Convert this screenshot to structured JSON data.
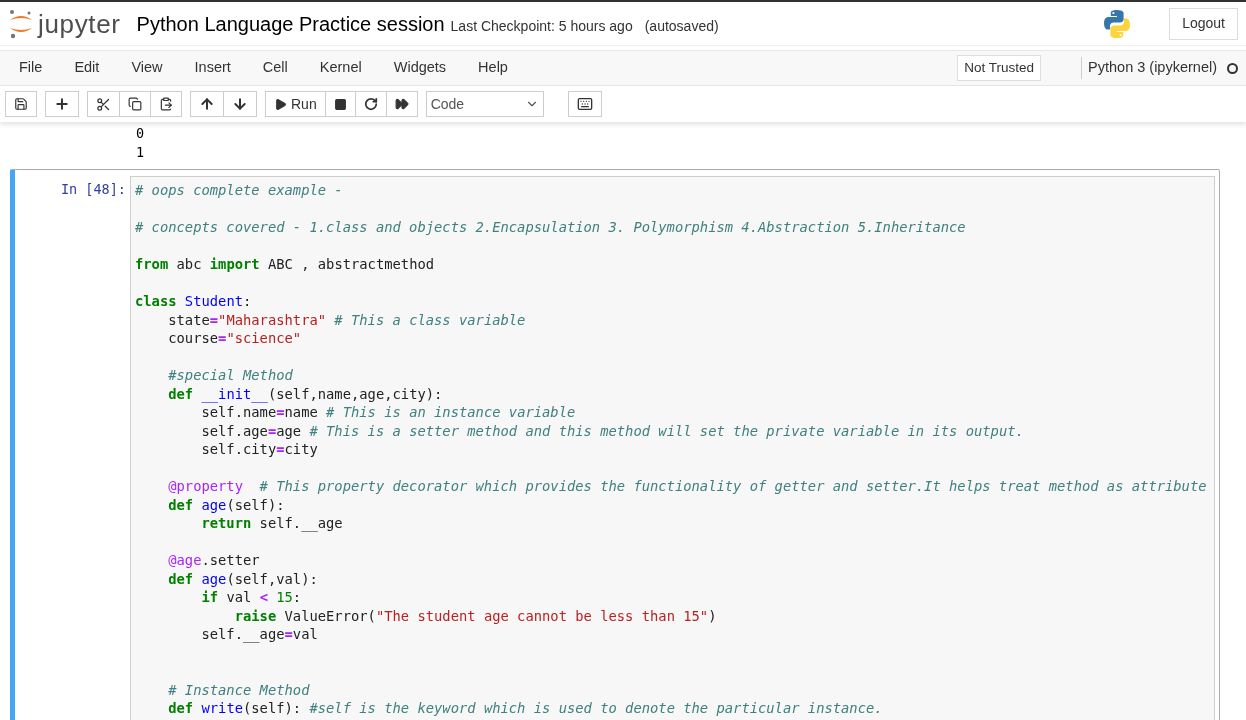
{
  "header": {
    "logo_text": "jupyter",
    "notebook_title": "Python Language Practice session",
    "checkpoint": "Last Checkpoint: 5 hours ago",
    "autosave": "(autosaved)",
    "logout": "Logout"
  },
  "menu": [
    "File",
    "Edit",
    "View",
    "Insert",
    "Cell",
    "Kernel",
    "Widgets",
    "Help"
  ],
  "trust": "Not Trusted",
  "kernel": {
    "name": "Python 3 (ipykernel)",
    "busy": false
  },
  "toolbar": {
    "run_label": "Run",
    "cell_type": "Code"
  },
  "output_lines": [
    "0",
    "1"
  ],
  "cell": {
    "prompt": "In [48]:",
    "selected": true,
    "lines": [
      {
        "kind": "code",
        "tokens": [
          {
            "text": "# oops complete example -",
            "kind": "comment"
          }
        ]
      },
      {
        "kind": "blank"
      },
      {
        "kind": "code",
        "tokens": [
          {
            "text": "# concepts covered - 1.class and objects 2.Encapsulation 3. Polymorphism 4.Abstraction 5.Inheritance",
            "kind": "comment"
          }
        ]
      },
      {
        "kind": "blank"
      },
      {
        "kind": "code",
        "tokens": [
          {
            "text": "from",
            "kind": "kw"
          },
          {
            "text": " abc ",
            "kind": "plain"
          },
          {
            "text": "import",
            "kind": "kw"
          },
          {
            "text": " ABC , abstractmethod",
            "kind": "plain"
          }
        ]
      },
      {
        "kind": "blank"
      },
      {
        "kind": "code",
        "tokens": [
          {
            "text": "class",
            "kind": "kw"
          },
          {
            "text": " Student",
            "kind": "name"
          },
          {
            "text": ":",
            "kind": "plain"
          }
        ]
      },
      {
        "kind": "code",
        "tokens": [
          {
            "text": "    state",
            "kind": "plain"
          },
          {
            "text": "=",
            "kind": "op"
          },
          {
            "text": "\"Maharashtra\"",
            "kind": "str"
          },
          {
            "text": " # This a class variable",
            "kind": "comment"
          }
        ]
      },
      {
        "kind": "code",
        "tokens": [
          {
            "text": "    course",
            "kind": "plain"
          },
          {
            "text": "=",
            "kind": "op"
          },
          {
            "text": "\"science\"",
            "kind": "str"
          }
        ]
      },
      {
        "kind": "blank"
      },
      {
        "kind": "code",
        "tokens": [
          {
            "text": "    #special Method",
            "kind": "comment"
          }
        ]
      },
      {
        "kind": "code",
        "tokens": [
          {
            "text": "    def",
            "kind": "kw"
          },
          {
            "text": " __init__",
            "kind": "name"
          },
          {
            "text": "(self,name,age,city):",
            "kind": "plain"
          }
        ]
      },
      {
        "kind": "code",
        "tokens": [
          {
            "text": "        self.name",
            "kind": "plain"
          },
          {
            "text": "=",
            "kind": "op"
          },
          {
            "text": "name ",
            "kind": "plain"
          },
          {
            "text": "# This is an instance variable",
            "kind": "comment"
          }
        ]
      },
      {
        "kind": "code",
        "tokens": [
          {
            "text": "        self.age",
            "kind": "plain"
          },
          {
            "text": "=",
            "kind": "op"
          },
          {
            "text": "age ",
            "kind": "plain"
          },
          {
            "text": "# This is a setter method and this method will set the private variable in its output.",
            "kind": "comment"
          }
        ]
      },
      {
        "kind": "code",
        "tokens": [
          {
            "text": "        self.city",
            "kind": "plain"
          },
          {
            "text": "=",
            "kind": "op"
          },
          {
            "text": "city",
            "kind": "plain"
          }
        ]
      },
      {
        "kind": "blank"
      },
      {
        "kind": "code",
        "tokens": [
          {
            "text": "    @property",
            "kind": "deco"
          },
          {
            "text": "  # This property decorator which provides the functionality of getter and setter.It helps treat method as attribute",
            "kind": "comment"
          }
        ]
      },
      {
        "kind": "code",
        "tokens": [
          {
            "text": "    def",
            "kind": "kw"
          },
          {
            "text": " age",
            "kind": "name"
          },
          {
            "text": "(self):",
            "kind": "plain"
          }
        ]
      },
      {
        "kind": "code",
        "tokens": [
          {
            "text": "        return",
            "kind": "kw"
          },
          {
            "text": " self.__age",
            "kind": "plain"
          }
        ]
      },
      {
        "kind": "blank"
      },
      {
        "kind": "code",
        "tokens": [
          {
            "text": "    @age",
            "kind": "deco"
          },
          {
            "text": ".setter",
            "kind": "plain"
          }
        ]
      },
      {
        "kind": "code",
        "tokens": [
          {
            "text": "    def",
            "kind": "kw"
          },
          {
            "text": " age",
            "kind": "name"
          },
          {
            "text": "(self,val):",
            "kind": "plain"
          }
        ]
      },
      {
        "kind": "code",
        "tokens": [
          {
            "text": "        if",
            "kind": "kw"
          },
          {
            "text": " val ",
            "kind": "plain"
          },
          {
            "text": "<",
            "kind": "op"
          },
          {
            "text": " 15",
            "kind": "num"
          },
          {
            "text": ":",
            "kind": "plain"
          }
        ]
      },
      {
        "kind": "code",
        "tokens": [
          {
            "text": "            raise",
            "kind": "kw"
          },
          {
            "text": " ValueError(",
            "kind": "plain"
          },
          {
            "text": "\"The student age cannot be less than 15\"",
            "kind": "str"
          },
          {
            "text": ")",
            "kind": "plain"
          }
        ]
      },
      {
        "kind": "code",
        "tokens": [
          {
            "text": "        self.__age",
            "kind": "plain"
          },
          {
            "text": "=",
            "kind": "op"
          },
          {
            "text": "val",
            "kind": "plain"
          }
        ]
      },
      {
        "kind": "blank"
      },
      {
        "kind": "blank"
      },
      {
        "kind": "code",
        "tokens": [
          {
            "text": "    # Instance Method",
            "kind": "comment"
          }
        ]
      },
      {
        "kind": "code",
        "tokens": [
          {
            "text": "    def",
            "kind": "kw"
          },
          {
            "text": " write",
            "kind": "name"
          },
          {
            "text": "(self): ",
            "kind": "plain"
          },
          {
            "text": "#self is the keyword which is used to denote the particular instance.",
            "kind": "comment"
          }
        ]
      }
    ]
  }
}
